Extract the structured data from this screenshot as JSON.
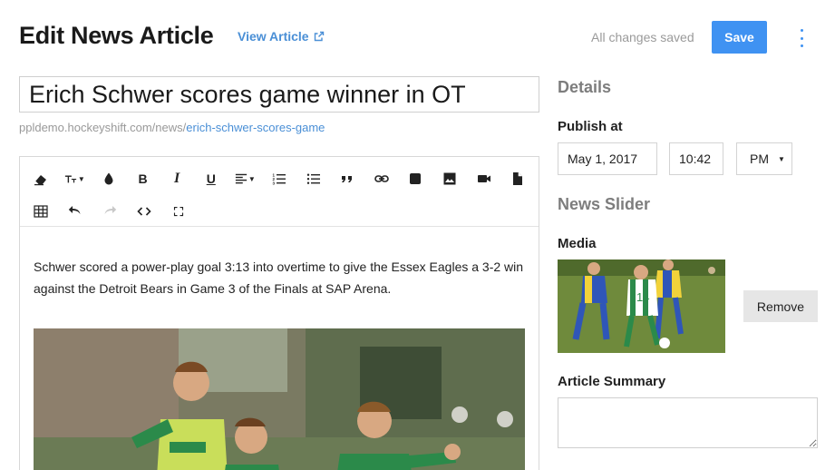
{
  "header": {
    "title": "Edit News Article",
    "view_link": "View Article",
    "status": "All changes saved",
    "save_label": "Save"
  },
  "article": {
    "title": "Erich Schwer scores game winner in OT",
    "slug_base": "ppldemo.hockeyshift.com/news/",
    "slug_path": "erich-schwer-scores-game",
    "body_text": "Schwer scored a power-play goal 3:13 into overtime to give the Essex Eagles a 3-2 win against the Detroit Bears in Game 3 of the Finals at SAP Arena."
  },
  "toolbar": {
    "row1": [
      "eraser-icon",
      "text-size-icon",
      "color-drop-icon",
      "bold-icon",
      "italic-icon",
      "underline-icon",
      "align-icon",
      "ordered-list-icon",
      "bullet-list-icon",
      "quote-icon",
      "link-icon",
      "table-block-icon",
      "image-icon",
      "video-icon",
      "file-icon"
    ],
    "row2": [
      "table-icon",
      "undo-icon",
      "redo-icon",
      "code-icon",
      "fullscreen-icon"
    ],
    "bold_glyph": "B",
    "italic_glyph": "I",
    "underline_glyph": "U"
  },
  "details": {
    "heading": "Details",
    "publish_label": "Publish at",
    "date": "May 1, 2017",
    "time": "10:42",
    "ampm": "PM"
  },
  "slider": {
    "heading": "News Slider",
    "media_label": "Media",
    "remove_label": "Remove"
  },
  "summary": {
    "label": "Article Summary",
    "value": ""
  },
  "colors": {
    "accent": "#3f92f2",
    "link": "#4a8fd6",
    "muted": "#7d7d7d"
  }
}
